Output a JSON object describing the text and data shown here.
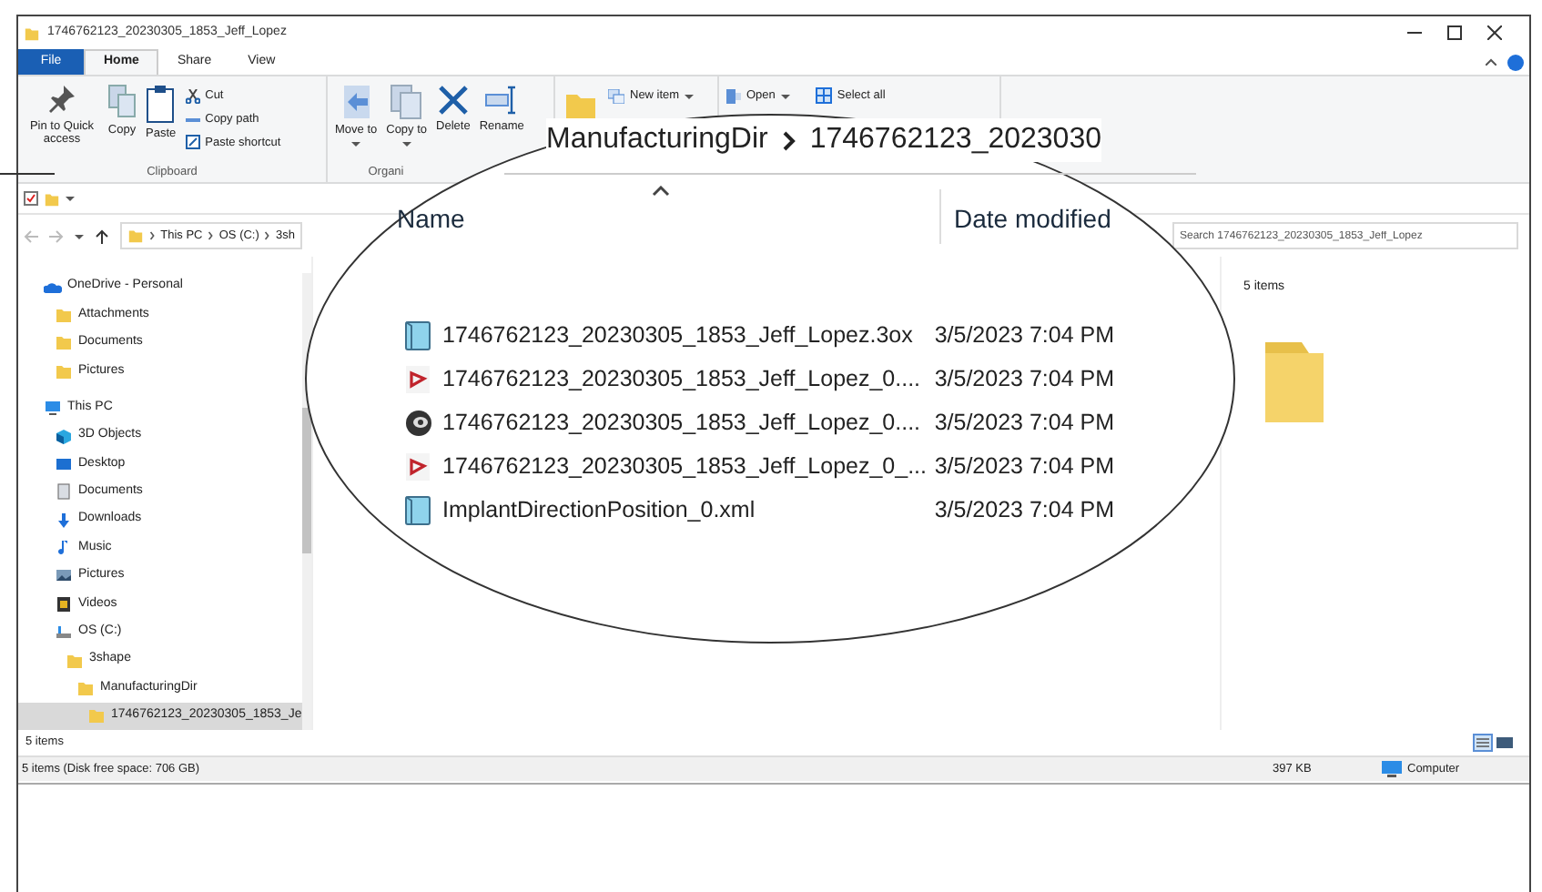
{
  "window": {
    "title": "1746762123_20230305_1853_Jeff_Lopez"
  },
  "ribbon_tabs": [
    {
      "label": "File",
      "kind": "file",
      "selected": false
    },
    {
      "label": "Home",
      "kind": "tab",
      "selected": true
    },
    {
      "label": "Share",
      "kind": "tab",
      "selected": false
    },
    {
      "label": "View",
      "kind": "tab",
      "selected": false
    }
  ],
  "ribbon_groups": [
    {
      "label": "Clipboard",
      "large_buttons": [
        "Pin to Quick access",
        "Copy",
        "Paste"
      ],
      "small_buttons": [
        "Cut",
        "Copy path",
        "Paste shortcut"
      ]
    },
    {
      "label": "Organi",
      "large_buttons": [
        "Move to",
        "Copy to",
        "Delete",
        "Rename"
      ]
    },
    {
      "small_buttons": [
        "New item"
      ]
    },
    {
      "small_buttons": [
        "Open",
        "Select all"
      ]
    }
  ],
  "address": {
    "crumbs": [
      "This PC",
      "OS (C:)",
      "3sh"
    ]
  },
  "search": {
    "placeholder": "Search 1746762123_20230305_1853_Jeff_Lopez"
  },
  "nav_tree": [
    {
      "label": "OneDrive - Personal",
      "kind": "cloud",
      "selected": false,
      "children": [
        {
          "label": "Attachments",
          "kind": "folder",
          "selected": false
        },
        {
          "label": "Documents",
          "kind": "folder",
          "selected": false
        },
        {
          "label": "Pictures",
          "kind": "folder",
          "selected": false
        }
      ]
    },
    {
      "label": "This PC",
      "kind": "computer",
      "selected": false,
      "children": [
        {
          "label": "3D Objects",
          "kind": "cube",
          "selected": false
        },
        {
          "label": "Desktop",
          "kind": "desktop",
          "selected": false
        },
        {
          "label": "Documents",
          "kind": "document",
          "selected": false
        },
        {
          "label": "Downloads",
          "kind": "download",
          "selected": false
        },
        {
          "label": "Music",
          "kind": "music",
          "selected": false
        },
        {
          "label": "Pictures",
          "kind": "image",
          "selected": false
        },
        {
          "label": "Videos",
          "kind": "video",
          "selected": false
        },
        {
          "label": "OS (C:)",
          "kind": "drive",
          "selected": false,
          "children": [
            {
              "label": "3shape",
              "kind": "folder",
              "selected": false,
              "children": [
                {
                  "label": "ManufacturingDir",
                  "kind": "folder",
                  "selected": false,
                  "children": [
                    {
                      "label": "1746762123_20230305_1853_Je",
                      "kind": "folder",
                      "selected": true
                    }
                  ]
                }
              ]
            }
          ]
        }
      ]
    }
  ],
  "item_count": "5 items",
  "preview": {
    "text": "5 items"
  },
  "status_bar": {
    "left": "5 items (Disk free space: 706 GB)",
    "size": "397 KB",
    "location": "Computer"
  },
  "magnifier": {
    "breadcrumb": [
      "ManufacturingDir",
      "1746762123_2023030"
    ],
    "columns": [
      "Name",
      "Date modified"
    ],
    "rows": [
      {
        "kind": "file",
        "name": "1746762123_20230305_1853_Jeff_Lopez.3ox",
        "date": "3/5/2023 7:04 PM"
      },
      {
        "kind": "pdf",
        "name": "1746762123_20230305_1853_Jeff_Lopez_0....",
        "date": "3/5/2023 7:04 PM"
      },
      {
        "kind": "app",
        "name": "1746762123_20230305_1853_Jeff_Lopez_0....",
        "date": "3/5/2023 7:04 PM"
      },
      {
        "kind": "pdf",
        "name": "1746762123_20230305_1853_Jeff_Lopez_0_...",
        "date": "3/5/2023 7:04 PM"
      },
      {
        "kind": "file",
        "name": "ImplantDirectionPosition_0.xml",
        "date": "3/5/2023 7:04 PM"
      }
    ]
  }
}
